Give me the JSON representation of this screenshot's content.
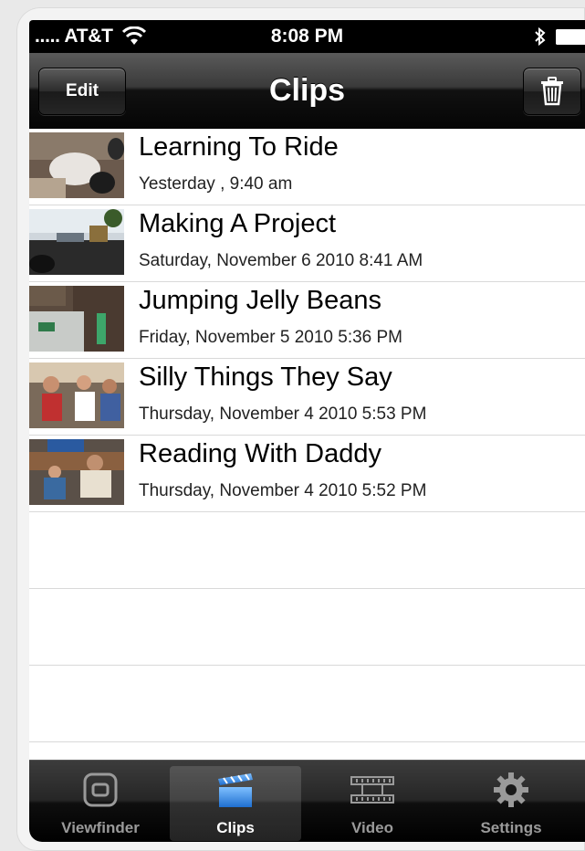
{
  "status": {
    "carrier": "..... AT&T",
    "time": "8:08 PM"
  },
  "nav": {
    "title": "Clips",
    "edit_label": "Edit"
  },
  "clips": [
    {
      "title": "Learning To Ride",
      "date": "Yesterday , 9:40 am"
    },
    {
      "title": "Making A Project",
      "date": "Saturday, November 6 2010 8:41 AM"
    },
    {
      "title": "Jumping Jelly Beans",
      "date": "Friday, November 5 2010 5:36 PM"
    },
    {
      "title": "Silly Things They Say",
      "date": "Thursday, November 4 2010 5:53 PM"
    },
    {
      "title": "Reading With Daddy",
      "date": "Thursday, November 4 2010 5:52 PM"
    }
  ],
  "tabs": [
    {
      "label": "Viewfinder",
      "icon": "viewfinder-icon",
      "selected": false
    },
    {
      "label": "Clips",
      "icon": "clapperboard-icon",
      "selected": true
    },
    {
      "label": "Video",
      "icon": "film-strip-icon",
      "selected": false
    },
    {
      "label": "Settings",
      "icon": "gear-icon",
      "selected": false
    }
  ],
  "colors": {
    "accent_blue": "#2f8be8",
    "bar_black": "#000000"
  }
}
